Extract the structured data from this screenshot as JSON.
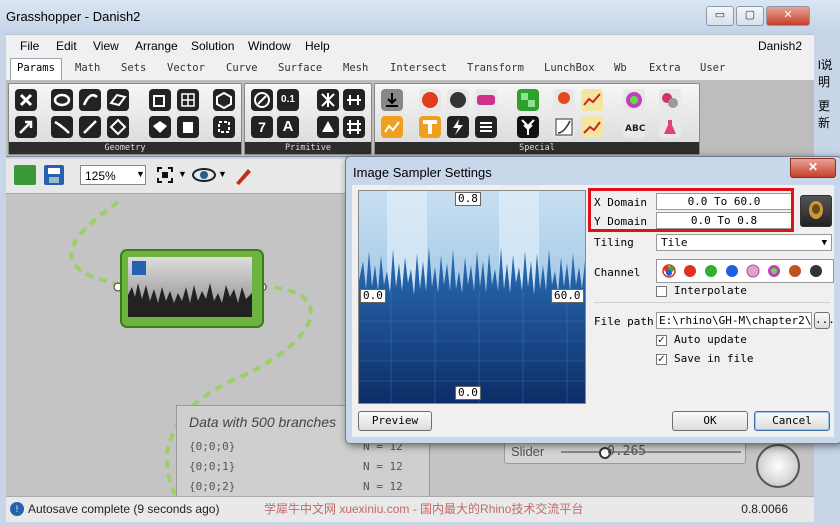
{
  "window": {
    "title": "Grasshopper - Danish2",
    "document_name": "Danish2",
    "minimize": "▭",
    "maximize": "▢",
    "close": "✕"
  },
  "menu": [
    "File",
    "Edit",
    "View",
    "Arrange",
    "Solution",
    "Window",
    "Help"
  ],
  "tabs": [
    "Params",
    "Math",
    "Sets",
    "Vector",
    "Curve",
    "Surface",
    "Mesh",
    "Intersect",
    "Transform",
    "LunchBox",
    "Wb",
    "Extra",
    "User"
  ],
  "toolbar_groups": {
    "geometry": "Geometry",
    "primitive": "Primitive",
    "special": "Special"
  },
  "primitive_icons": {
    "number": "0.1",
    "integer": "7",
    "text": "A"
  },
  "canvas": {
    "zoom": "125%"
  },
  "data_panel": {
    "title": "Data with 500 branches",
    "rows": [
      {
        "path": "{0;0;0}",
        "count": "N = 12"
      },
      {
        "path": "{0;0;1}",
        "count": "N = 12"
      },
      {
        "path": "{0;0;2}",
        "count": "N = 12"
      }
    ]
  },
  "slider": {
    "label": "Slider",
    "value": "0.265"
  },
  "status": {
    "autosave": "Autosave complete (9 seconds ago)",
    "watermark": "学犀牛中文网 xuexiniu.com - 国内最大的Rhino技术交流平台",
    "version": "0.8.0066"
  },
  "side_text": {
    "line1": "l说明",
    "line2": "更新"
  },
  "dialog": {
    "title": "Image Sampler Settings",
    "close": "✕",
    "preview_labels": {
      "top": "0.8",
      "left": "0.0",
      "right": "60.0",
      "bottom": "0.0"
    },
    "x_domain_label": "X Domain",
    "x_domain_value": "0.0 To 60.0",
    "y_domain_label": "Y Domain",
    "y_domain_value": "0.0 To 0.8",
    "tiling_label": "Tiling",
    "tiling_value": "Tile",
    "channel_label": "Channel",
    "interpolate_label": "Interpolate",
    "interpolate_checked": false,
    "file_path_label": "File path",
    "file_path_value": "E:\\rhino\\GH-M\\chapter2\\ci",
    "browse_label": "...",
    "auto_update_label": "Auto update",
    "auto_update_checked": true,
    "save_in_file_label": "Save in file",
    "save_in_file_checked": true,
    "preview_button": "Preview",
    "ok_button": "OK",
    "cancel_button": "Cancel",
    "check_mark": "✓"
  },
  "colors": {
    "highlight": "#e0101a",
    "component_green": "#6cb33f",
    "preview_blue": "#1b5fa8"
  }
}
